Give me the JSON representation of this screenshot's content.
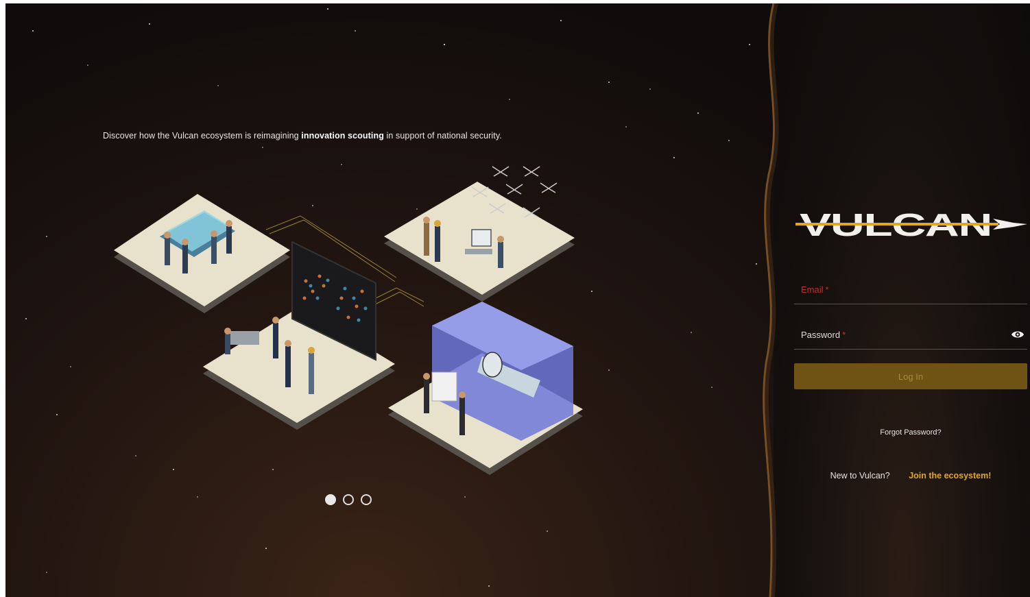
{
  "hero": {
    "tagline_pre": "Discover how the Vulcan ecosystem is reimagining ",
    "tagline_bold": "innovation scouting",
    "tagline_post": " in support of national security."
  },
  "carousel": {
    "slides": 3,
    "active_index": 0
  },
  "logo": {
    "text": "VULCAN"
  },
  "login_form": {
    "email_label": "Email",
    "password_label": "Password",
    "required_marker": "*",
    "login_button": "Log In",
    "forgot_password": "Forgot Password?",
    "new_user_prompt": "New to Vulcan?",
    "signup_link": "Join the ecosystem!"
  },
  "colors": {
    "accent_gold": "#e0a820",
    "button_bg": "#6e5314",
    "error_red": "#c0322e"
  },
  "icons": {
    "password_toggle": "eye-icon"
  }
}
